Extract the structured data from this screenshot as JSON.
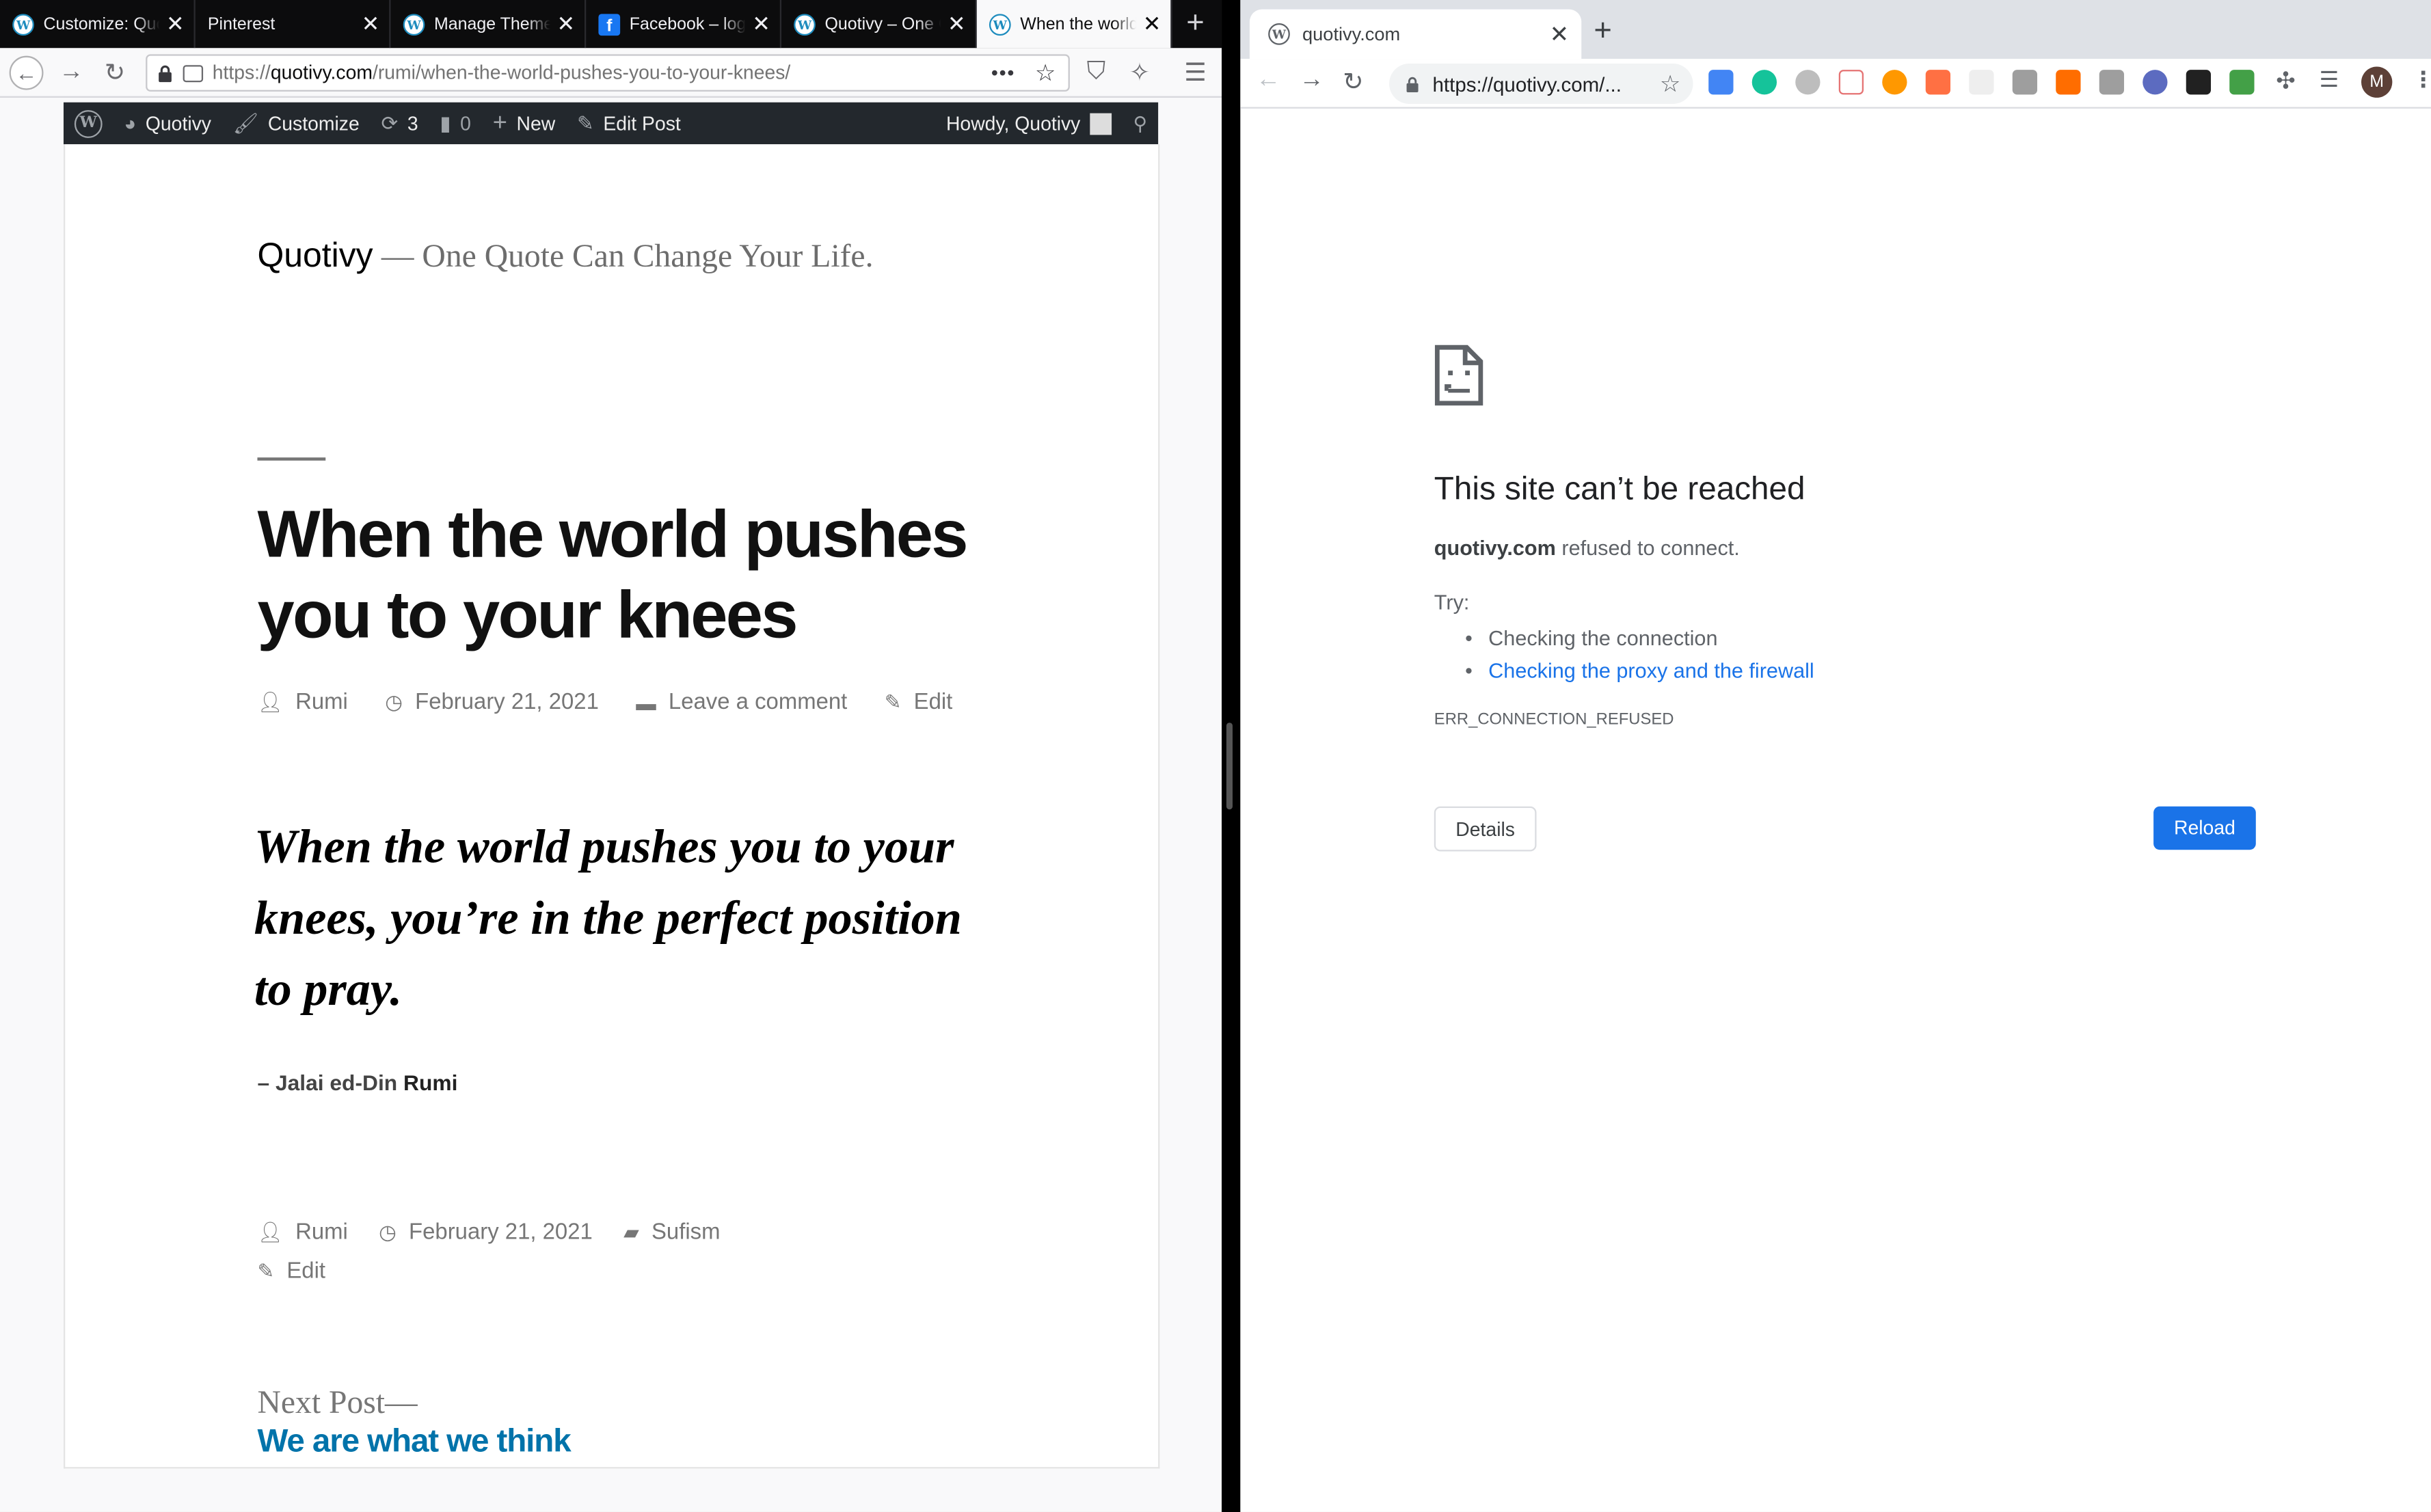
{
  "firefox": {
    "tabs": [
      {
        "title": "Customize: Quotivy",
        "icon": "wordpress-icon"
      },
      {
        "title": "Pinterest",
        "icon": "pinterest-icon"
      },
      {
        "title": "Manage Themes",
        "icon": "wordpress-icon"
      },
      {
        "title": "Facebook – log in",
        "icon": "facebook-icon"
      },
      {
        "title": "Quotivy – One Quote",
        "icon": "wordpress-icon"
      },
      {
        "title": "When the world",
        "icon": "wordpress-icon",
        "active": true
      }
    ],
    "url_prefix": "https://",
    "url_domain": "quotivy.com",
    "url_path": "/rumi/when-the-world-pushes-you-to-your-knees/",
    "page_actions": "•••"
  },
  "wp_admin_bar": {
    "site_name": "Quotivy",
    "customize": "Customize",
    "updates_count": "3",
    "comments_count": "0",
    "new": "New",
    "edit_post": "Edit Post",
    "howdy": "Howdy, Quotivy"
  },
  "post": {
    "site_title": "Quotivy",
    "site_description": "— One Quote Can Change Your Life.",
    "title": "When the world pushes you to your knees",
    "author": "Rumi",
    "date": "February 21, 2021",
    "comment_link": "Leave a comment",
    "edit": "Edit",
    "quote": "When the world pushes you to your knees, you’re in the perfect position to pray.",
    "attribution_prefix": "– Jalai ed-Din ",
    "attribution_name": "Rumi",
    "footer_author": "Rumi",
    "footer_date": "February 21, 2021",
    "category": "Sufism",
    "footer_edit": "Edit",
    "next_label": "Next Post—",
    "next_title": "We are what we think"
  },
  "chrome": {
    "tab_title": "quotivy.com",
    "omnibox": "https://quotivy.com/...",
    "avatar_letter": "M",
    "error": {
      "title": "This site can’t be reached",
      "domain": "quotivy.com",
      "message": " refused to connect.",
      "try": "Try:",
      "suggestions": [
        "Checking the connection",
        "Checking the proxy and the firewall"
      ],
      "code": "ERR_CONNECTION_REFUSED",
      "details_button": "Details",
      "reload_button": "Reload"
    }
  },
  "colors": {
    "wp_link": "#0073aa",
    "chrome_blue": "#1a73e8",
    "admin_bar": "#23282d"
  }
}
